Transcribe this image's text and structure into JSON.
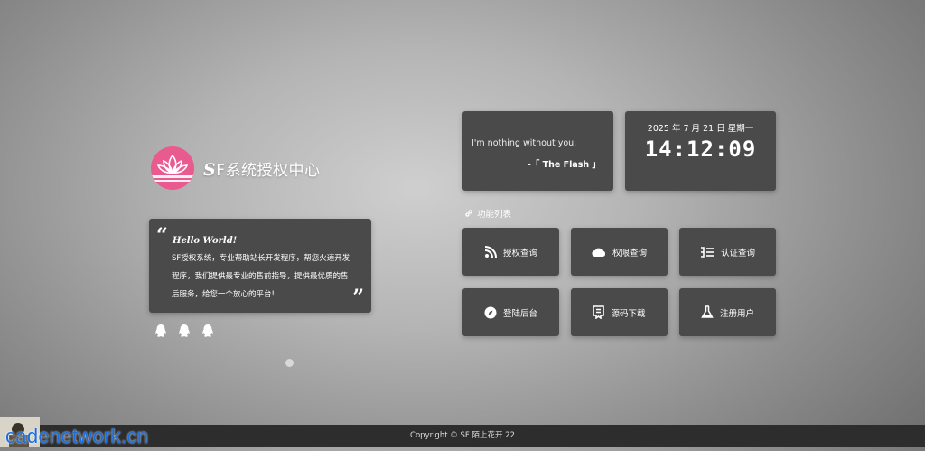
{
  "brand": {
    "title_prefix": "S",
    "title_rest": "F系统授权中心",
    "logo_icon": "lotus-icon",
    "accent": "#e95a8f"
  },
  "quote_card": {
    "hello": "Hello World!",
    "description": "SF授权系统，专业帮助站长开发程序，帮您火速开发程序，我们提供最专业的售前指导，提供最优质的售后服务，给您一个放心的平台!"
  },
  "socials": [
    "qq-icon",
    "qq-icon",
    "qq-icon"
  ],
  "motto": {
    "line": "I'm nothing without you.",
    "author": "-「 The Flash 」"
  },
  "clock": {
    "date": "2025 年 7 月 21 日 星期一",
    "time": "14:12:09"
  },
  "section": {
    "title": "功能列表"
  },
  "buttons": [
    {
      "label": "授权查询",
      "icon": "rss-icon"
    },
    {
      "label": "权限查询",
      "icon": "cloud-icon"
    },
    {
      "label": "认证查询",
      "icon": "list-icon"
    },
    {
      "label": "登陆后台",
      "icon": "compass-icon"
    },
    {
      "label": "源码下载",
      "icon": "download-icon"
    },
    {
      "label": "注册用户",
      "icon": "flask-icon"
    }
  ],
  "footer": {
    "copyright": "Copyright © SF 陌上花开   22"
  },
  "watermark": {
    "text": "cadenetwork.cn"
  }
}
